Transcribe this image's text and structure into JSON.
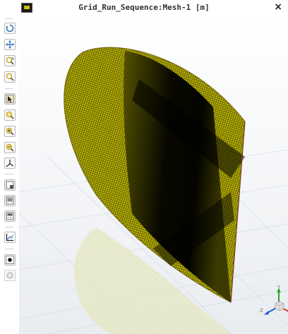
{
  "window": {
    "title": "Grid_Run_Sequence:Mesh-1 [m]",
    "close_glyph": "×"
  },
  "toolbar": {
    "buttons": [
      {
        "name": "rotate-icon"
      },
      {
        "name": "pan-icon"
      },
      {
        "name": "zoom-dynamic-icon"
      },
      {
        "name": "zoom-box-icon"
      },
      {
        "name": "select-icon"
      },
      {
        "name": "zoom-fit-icon"
      },
      {
        "name": "zoom-in-icon"
      },
      {
        "name": "zoom-out-icon"
      },
      {
        "name": "axes-view-icon"
      },
      {
        "name": "view-layout-icon"
      },
      {
        "name": "single-view-icon"
      },
      {
        "name": "split-view-icon"
      },
      {
        "name": "chart-icon"
      },
      {
        "name": "record-icon"
      },
      {
        "name": "play-icon"
      }
    ]
  },
  "triad": {
    "z_label": "Z",
    "x_label": "X",
    "y_label": "Y",
    "y_color": "#22aa22",
    "x_color": "#d63030",
    "z_color": "#2060d0"
  },
  "colors": {
    "mesh": "#b9b300",
    "mesh_line": "#000000",
    "edge": "#7a6a10"
  }
}
